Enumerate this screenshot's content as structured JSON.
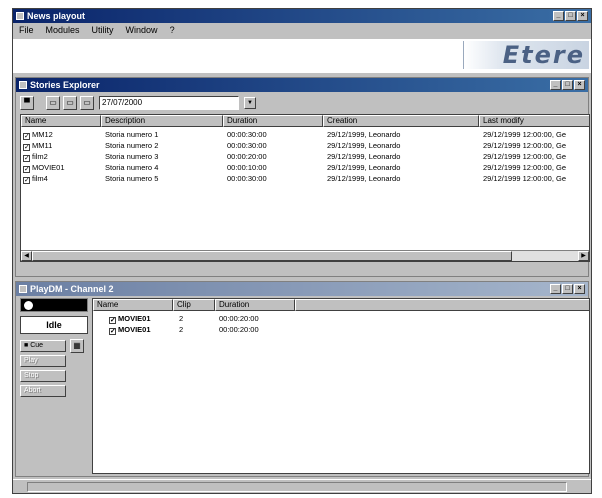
{
  "app": {
    "title": "News playout",
    "menu": [
      "File",
      "Modules",
      "Utility",
      "Window",
      "?"
    ],
    "logo_text": "Etere"
  },
  "explorer": {
    "title": "Stories Explorer",
    "date": "27/07/2000",
    "columns": [
      "Name",
      "Description",
      "Duration",
      "Creation",
      "Last modify"
    ],
    "rows": [
      {
        "name": "MM12",
        "description": "Storia numero 1",
        "duration": "00:00:30:00",
        "creation": "29/12/1999, Leonardo",
        "modify": "29/12/1999 12:00:00, Ge"
      },
      {
        "name": "MM11",
        "description": "Storia numero 2",
        "duration": "00:00:30:00",
        "creation": "29/12/1999, Leonardo",
        "modify": "29/12/1999 12:00:00, Ge"
      },
      {
        "name": "film2",
        "description": "Storia numero 3",
        "duration": "00:00:20:00",
        "creation": "29/12/1999, Leonardo",
        "modify": "29/12/1999 12:00:00, Ge"
      },
      {
        "name": "MOVIE01",
        "description": "Storia numero 4",
        "duration": "00:00:10:00",
        "creation": "29/12/1999, Leonardo",
        "modify": "29/12/1999 12:00:00, Ge"
      },
      {
        "name": "film4",
        "description": "Storia numero 5",
        "duration": "00:00:30:00",
        "creation": "29/12/1999, Leonardo",
        "modify": "29/12/1999 12:00:00, Ge"
      }
    ]
  },
  "playlist": {
    "title": "PlayDM - Channel 2",
    "status": "Idle",
    "buttons": [
      "Cue",
      "Play",
      "Stop",
      "Abort"
    ],
    "columns": [
      "Name",
      "Clip",
      "Duration"
    ],
    "rows": [
      {
        "name": "MOVIE01",
        "clip": "2",
        "duration": "00:00:20:00"
      },
      {
        "name": "MOVIE01",
        "clip": "2",
        "duration": "00:00:20:00"
      }
    ]
  },
  "icons": [
    "app-icon",
    "folder-icon",
    "calendar-icon",
    "window-min-icon",
    "window-max-icon",
    "close-icon",
    "checkbox-icon",
    "play-channel-icon",
    "grid-icon"
  ]
}
